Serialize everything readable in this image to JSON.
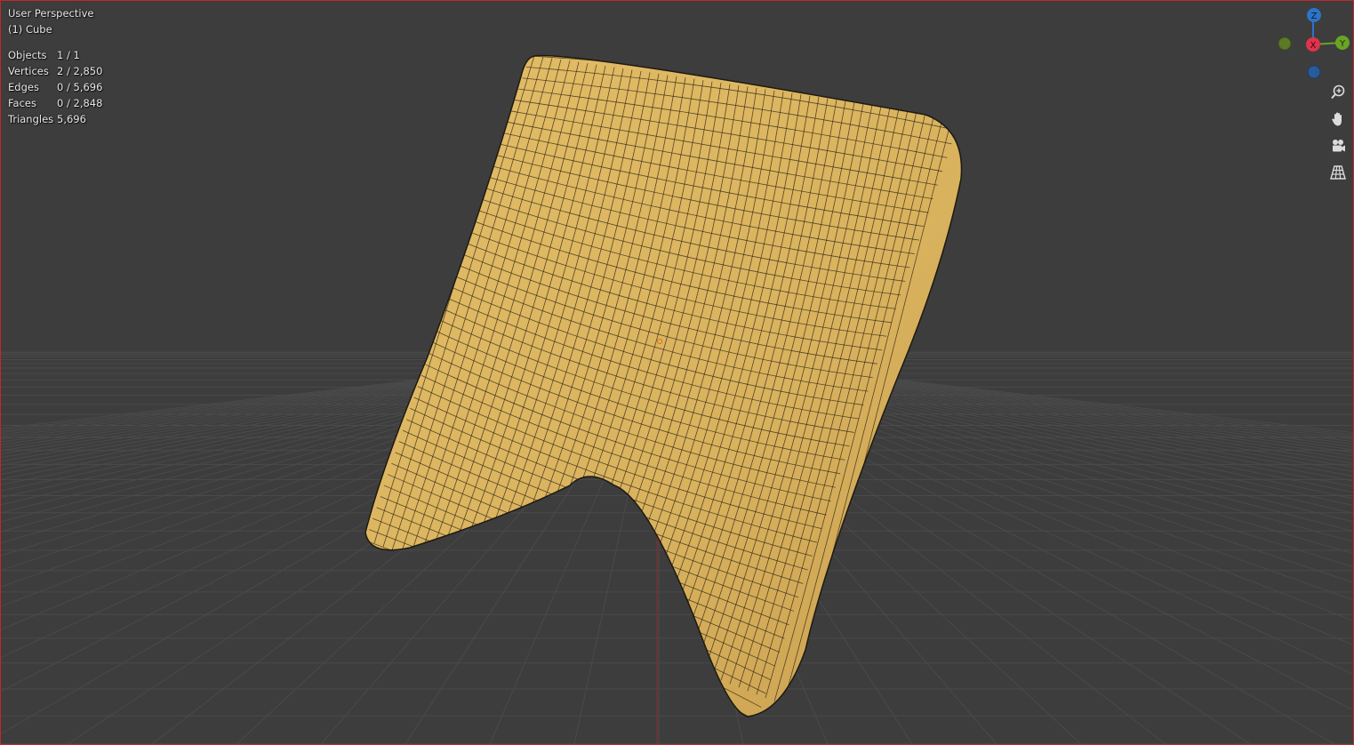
{
  "viewport": {
    "view_name": "User Perspective",
    "object_name": "(1) Cube"
  },
  "stats": [
    {
      "label": "Objects",
      "value": "1 / 1"
    },
    {
      "label": "Vertices",
      "value": "2 / 2,850"
    },
    {
      "label": "Edges",
      "value": "0 / 5,696"
    },
    {
      "label": "Faces",
      "value": "0 / 2,848"
    },
    {
      "label": "Triangles",
      "value": "5,696"
    }
  ],
  "gizmo": {
    "z_label": "Z",
    "x_label": "X",
    "y_label": "Y",
    "colors": {
      "z": "#2c74c9",
      "x": "#e0334c",
      "y": "#6aa326",
      "neg_y": "#5a7a28",
      "neg_z": "#2a5a99"
    }
  },
  "nav_icons": [
    "zoom-icon",
    "hand-pan-icon",
    "camera-icon",
    "grid-perspective-icon"
  ],
  "colors": {
    "background": "#3d3d3d",
    "mesh_fill": "#d8b35f",
    "wire": "#2a2312",
    "grid": "#4a4a4a",
    "border": "#c0282b"
  }
}
